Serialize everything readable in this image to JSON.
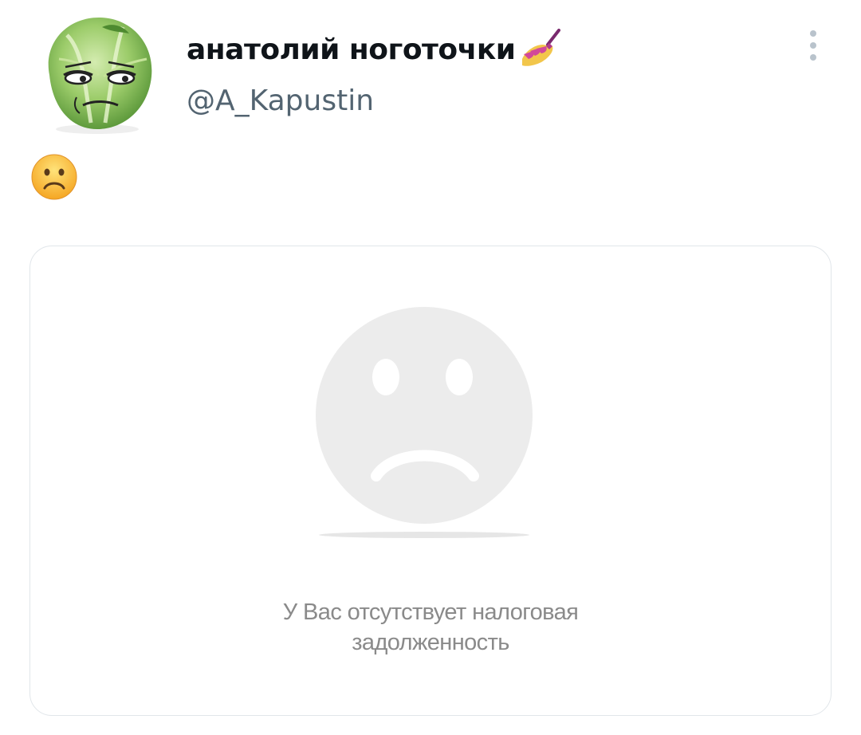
{
  "tweet": {
    "author": {
      "display_name": "анатолий ноготочки",
      "name_emoji": "nail-polish-icon",
      "handle": "@A_Kapustin",
      "avatar": "cabbage-face-avatar"
    },
    "more_menu_icon": "more-vertical-icon",
    "body_emoji": "frowning-face-icon",
    "media": {
      "image": "sad-face-icon",
      "message_line1": "У Вас отсутствует налоговая",
      "message_line2": "задолженность"
    }
  }
}
